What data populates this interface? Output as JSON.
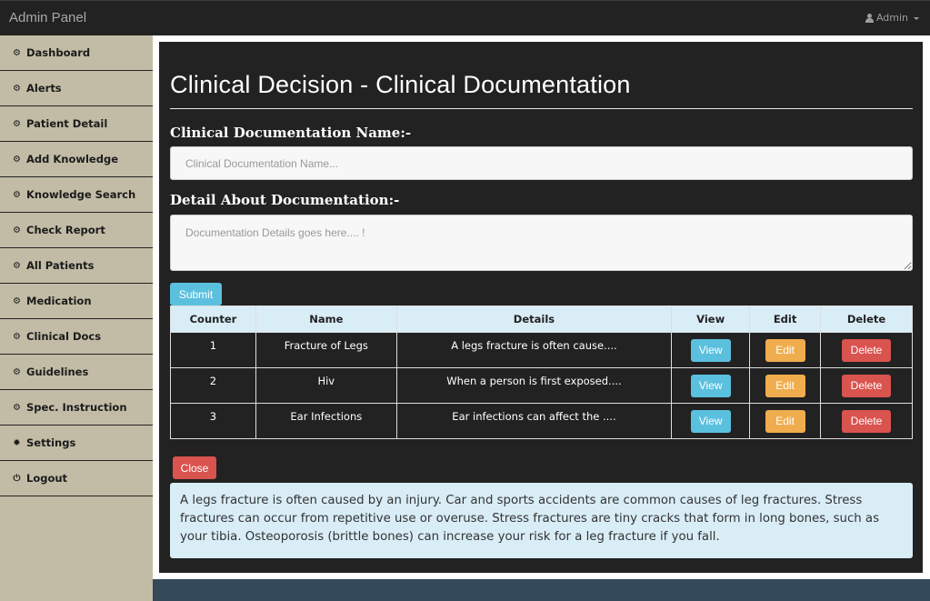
{
  "header": {
    "brand": "Admin Panel",
    "user_label": "Admin",
    "user_icon": "user-icon"
  },
  "sidebar": {
    "items": [
      {
        "label": "Dashboard",
        "icon": "dashboard-icon",
        "glyph": "⚙"
      },
      {
        "label": "Alerts",
        "icon": "dashboard-icon",
        "glyph": "⚙"
      },
      {
        "label": "Patient Detail",
        "icon": "dashboard-icon",
        "glyph": "⚙"
      },
      {
        "label": "Add Knowledge",
        "icon": "dashboard-icon",
        "glyph": "⚙"
      },
      {
        "label": "Knowledge Search",
        "icon": "dashboard-icon",
        "glyph": "⚙"
      },
      {
        "label": "Check Report",
        "icon": "dashboard-icon",
        "glyph": "⚙"
      },
      {
        "label": "All Patients",
        "icon": "dashboard-icon",
        "glyph": "⚙"
      },
      {
        "label": "Medication",
        "icon": "dashboard-icon",
        "glyph": "⚙"
      },
      {
        "label": "Clinical Docs",
        "icon": "dashboard-icon",
        "glyph": "⚙"
      },
      {
        "label": "Guidelines",
        "icon": "dashboard-icon",
        "glyph": "⚙"
      },
      {
        "label": "Spec. Instruction",
        "icon": "dashboard-icon",
        "glyph": "⚙"
      },
      {
        "label": "Settings",
        "icon": "gear-icon",
        "glyph": "✹"
      },
      {
        "label": "Logout",
        "icon": "power-icon",
        "glyph": "⏻"
      }
    ]
  },
  "main": {
    "title": "Clinical Decision - Clinical Documentation",
    "name_label": "Clinical Documentation Name:-",
    "name_placeholder": "Clinical Documentation Name...",
    "name_value": "",
    "detail_label": "Detail About Documentation:-",
    "detail_placeholder": "Documentation Details goes here.... !",
    "detail_value": "",
    "submit_label": "Submit",
    "table": {
      "headers": [
        "Counter",
        "Name",
        "Details",
        "View",
        "Edit",
        "Delete"
      ],
      "rows": [
        {
          "counter": "1",
          "name": "Fracture of Legs",
          "details": "A legs fracture is often cause....",
          "view": "View",
          "edit": "Edit",
          "delete": "Delete"
        },
        {
          "counter": "2",
          "name": "Hiv",
          "details": "When a person is first exposed....",
          "view": "View",
          "edit": "Edit",
          "delete": "Delete"
        },
        {
          "counter": "3",
          "name": "Ear Infections",
          "details": "Ear infections can affect the ....",
          "view": "View",
          "edit": "Edit",
          "delete": "Delete"
        }
      ]
    },
    "close_label": "Close",
    "detail_text": "A legs fracture is often caused by an injury. Car and sports accidents are common causes of leg fractures. Stress fractures can occur from repetitive use or overuse. Stress fractures are tiny cracks that form in long bones, such as your tibia. Osteoporosis (brittle bones) can increase your risk for a leg fracture if you fall."
  },
  "colors": {
    "topbar": "#222222",
    "sidebar": "#c2bca6",
    "panel": "#222222",
    "info": "#5bc0de",
    "warning": "#f0ad4e",
    "danger": "#d9534f",
    "table_header": "#d9edf7",
    "footer": "#34495a"
  }
}
